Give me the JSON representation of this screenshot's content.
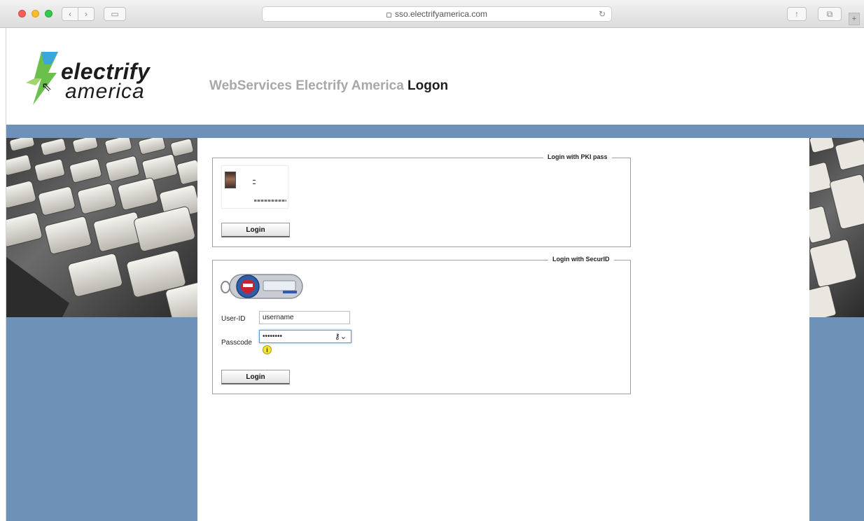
{
  "browser": {
    "url": "sso.electrifyamerica.com",
    "back_icon": "chevron-left-icon",
    "forward_icon": "chevron-right-icon",
    "sidebar_icon": "sidebar-icon",
    "reload_icon": "reload-icon",
    "share_icon": "share-icon",
    "tabs_icon": "tabs-icon"
  },
  "header": {
    "logo_line1": "electrify",
    "logo_line2": "america",
    "title_light": "WebServices Electrify America",
    "title_strong": "Logon"
  },
  "pki": {
    "legend": "Login with PKI pass",
    "login_label": "Login"
  },
  "securid": {
    "legend": "Login with SecurID",
    "userid_label": "User-ID",
    "userid_value": "username",
    "passcode_label": "Passcode",
    "passcode_value": "••••••••",
    "login_label": "Login"
  },
  "colors": {
    "band_blue": "#6e91b8",
    "logo_green": "#6bc04b",
    "logo_blue": "#3aa6d9"
  }
}
